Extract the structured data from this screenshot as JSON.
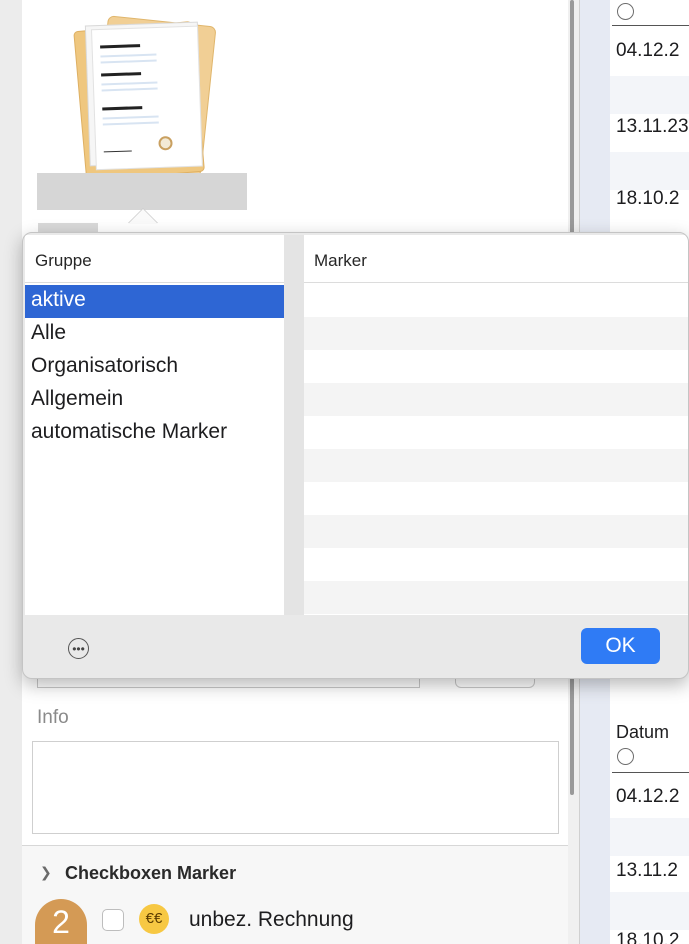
{
  "popover": {
    "group_header": "Gruppe",
    "marker_header": "Marker",
    "groups": [
      "aktive",
      "Alle",
      "Organisatorisch",
      "Allgemein",
      "automatische Marker"
    ],
    "selected_group": "aktive",
    "ok_label": "OK",
    "options_glyph": "•••"
  },
  "form": {
    "info_label": "Info",
    "info_value": ""
  },
  "checkboxes_section": {
    "title": "Checkboxen Marker",
    "badge_number": "2",
    "items": [
      {
        "label": "unbez. Rechnung",
        "checked": false,
        "icon": "worried-face-emoji"
      }
    ]
  },
  "right_table": {
    "column_header": "Datum",
    "top_dates": [
      "04.12.2",
      "13.11.23",
      "18.10.2"
    ],
    "bottom_dates": [
      "04.12.2",
      "13.11.2",
      "18.10.2"
    ]
  },
  "colors": {
    "selection": "#2e66d4",
    "ok_button": "#2f7bf5",
    "badge": "#d49a55"
  }
}
